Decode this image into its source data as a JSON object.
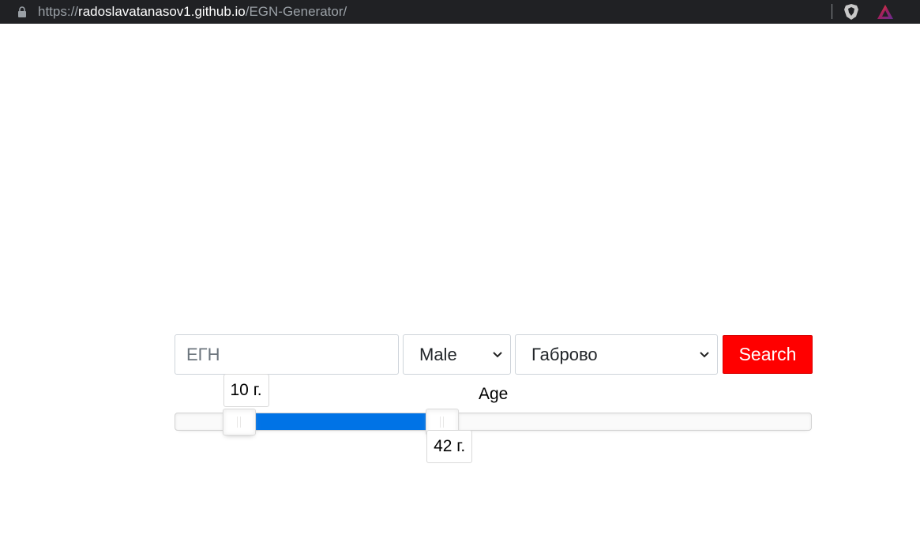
{
  "browser": {
    "url_scheme": "https://",
    "url_host": "radoslavatanasov1.github.io",
    "url_path": "/EGN-Generator/"
  },
  "form": {
    "egn_placeholder": "ЕГН",
    "egn_value": "",
    "gender_selected": "Male",
    "city_selected": "Габрово",
    "search_label": "Search"
  },
  "age": {
    "label": "Age",
    "range_min": 0,
    "range_max": 100,
    "lower_value": 10,
    "upper_value": 42,
    "lower_tooltip": "10 г.",
    "upper_tooltip": "42 г.",
    "connect_color": "#0073e6"
  },
  "colors": {
    "search_button": "#ff0000",
    "browser_bar": "#202124"
  }
}
